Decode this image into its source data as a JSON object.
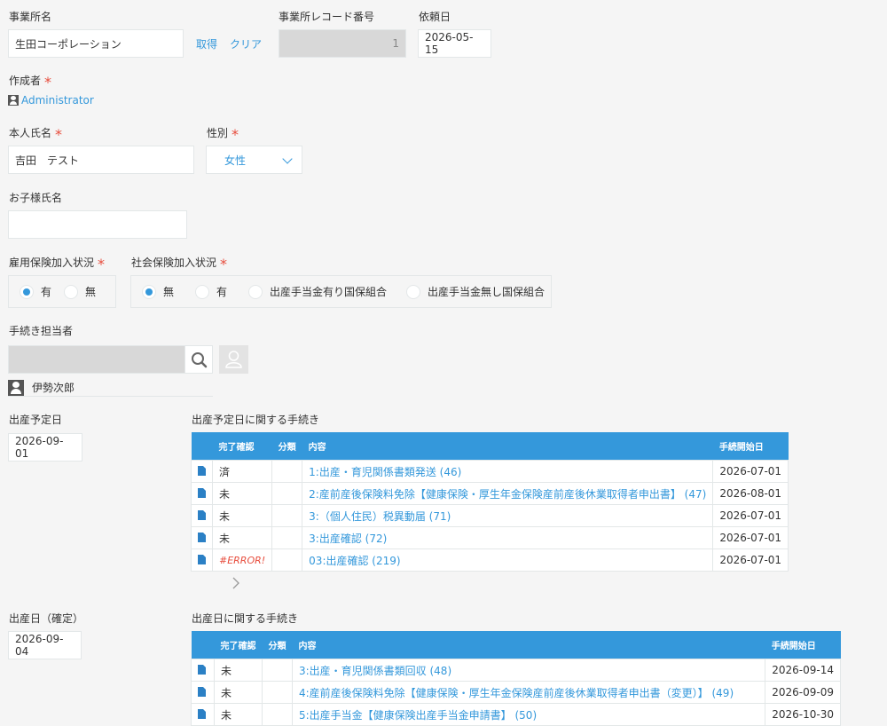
{
  "office": {
    "label": "事業所名",
    "value": "生田コーポレーション",
    "fetch_link": "取得",
    "clear_link": "クリア"
  },
  "record_no": {
    "label": "事業所レコード番号",
    "value": "1"
  },
  "request_date": {
    "label": "依頼日",
    "value": "2026-05-15"
  },
  "creator": {
    "label": "作成者",
    "required": "*",
    "value": "Administrator"
  },
  "person_name": {
    "label": "本人氏名",
    "required": "*",
    "value": "吉田　テスト"
  },
  "gender": {
    "label": "性別",
    "required": "*",
    "value": "女性"
  },
  "child_name": {
    "label": "お子様氏名",
    "value": ""
  },
  "employment_insurance": {
    "label": "雇用保険加入状況",
    "required": "*",
    "options": [
      "有",
      "無"
    ],
    "selected": "有"
  },
  "social_insurance": {
    "label": "社会保険加入状況",
    "required": "*",
    "options": [
      "無",
      "有",
      "出産手当金有り国保組合",
      "出産手当金無し国保組合"
    ],
    "selected": "無"
  },
  "handler": {
    "label": "手続き担当者",
    "search_value": "",
    "selected_user": "伊勢次郎"
  },
  "due_date": {
    "label": "出産予定日",
    "value": "2026-09-01"
  },
  "due_procedures": {
    "label": "出産予定日に関する手続き",
    "headers": [
      "完了確認",
      "分類",
      "内容",
      "手続開始日"
    ],
    "rows": [
      {
        "status": "済",
        "category": "",
        "content": "1:出産・育児関係書類発送 (46)",
        "start": "2026-07-01"
      },
      {
        "status": "未",
        "category": "",
        "content": "2:産前産後保険料免除【健康保険・厚生年金保険産前産後休業取得者申出書】 (47)",
        "start": "2026-08-01"
      },
      {
        "status": "未",
        "category": "",
        "content": "3:（個人住民）税異動届 (71)",
        "start": "2026-07-01"
      },
      {
        "status": "未",
        "category": "",
        "content": "3:出産確認 (72)",
        "start": "2026-07-01"
      },
      {
        "status": "#ERROR!",
        "category": "",
        "content": "03:出産確認 (219)",
        "start": "2026-07-01"
      }
    ]
  },
  "birth_date": {
    "label": "出産日（確定）",
    "value": "2026-09-04"
  },
  "birth_procedures": {
    "label": "出産日に関する手続き",
    "headers": [
      "完了確認",
      "分類",
      "内容",
      "手続開始日"
    ],
    "rows": [
      {
        "status": "未",
        "category": "",
        "content": "3:出産・育児関係書類回収 (48)",
        "start": "2026-09-14"
      },
      {
        "status": "未",
        "category": "",
        "content": "4:産前産後保険料免除【健康保険・厚生年金保険産前産後休業取得者申出書（変更）】 (49)",
        "start": "2026-09-09"
      },
      {
        "status": "未",
        "category": "",
        "content": "5:出産手当金【健康保険出産手当金申請書】 (50)",
        "start": "2026-10-30"
      }
    ]
  },
  "colors": {
    "accent": "#3498db",
    "required": "#e74c3c",
    "background": "#f5f5f5"
  },
  "icons": [
    "user-icon",
    "search-icon",
    "user-picker-icon",
    "document-icon",
    "chevron-down-icon",
    "chevron-right-icon"
  ]
}
